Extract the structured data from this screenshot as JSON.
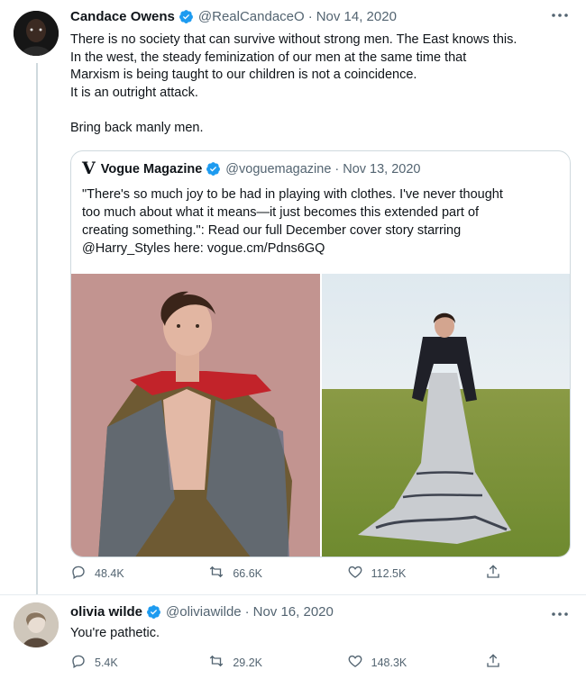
{
  "tweets": [
    {
      "name": "Candace Owens",
      "handle": "@RealCandaceO",
      "separator": "·",
      "date": "Nov 14, 2020",
      "lines": [
        "There is no society that can survive without strong men. The East knows this.",
        "In the west, the steady feminization of our men at the same time that",
        "Marxism is being taught to our children is not a coincidence.",
        "It is an outright attack.",
        "",
        "Bring back manly men."
      ],
      "quote": {
        "logo": "V",
        "name": "Vogue Magazine",
        "handle": "@voguemagazine",
        "separator": "·",
        "date": "Nov 13, 2020",
        "lines": [
          "\"There's so much joy to be had in playing with clothes. I've never thought",
          "too much about what it means—it just becomes this extended part of",
          "creating something.\": Read our full December cover story starring",
          "@Harry_Styles here: vogue.cm/Pdns6GQ"
        ]
      },
      "stats": {
        "replies": "48.4K",
        "retweets": "66.6K",
        "likes": "112.5K"
      }
    },
    {
      "name": "olivia wilde",
      "handle": "@oliviawilde",
      "separator": "·",
      "date": "Nov 16, 2020",
      "text": "You're pathetic.",
      "stats": {
        "replies": "5.4K",
        "retweets": "29.2K",
        "likes": "148.3K"
      }
    }
  ],
  "icons": {
    "verified": "verified-badge-icon",
    "more": "more-dots-icon",
    "reply": "reply-icon",
    "retweet": "retweet-icon",
    "like": "heart-icon",
    "share": "share-icon"
  },
  "colors": {
    "verified": "#1d9bf0",
    "text": "#0f1419",
    "muted": "#536471",
    "border": "#cfd9de"
  }
}
